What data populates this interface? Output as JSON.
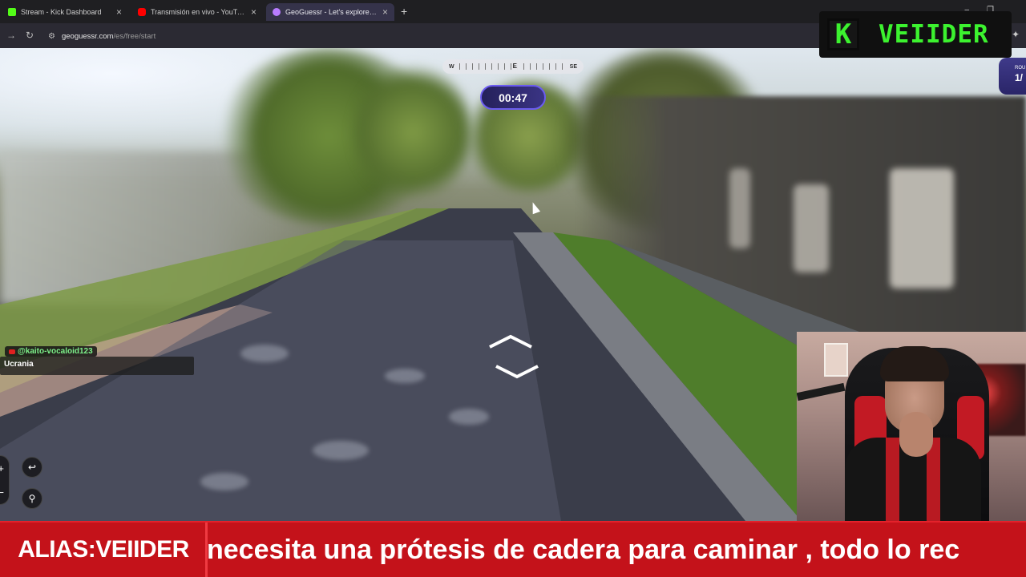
{
  "browser": {
    "tabs": [
      {
        "label": "Stream - Kick Dashboard",
        "favicon_color": "#53fc18",
        "favicon_glyph": "K"
      },
      {
        "label": "Transmisión en vivo - YouTube",
        "favicon_color": "#ff0000",
        "favicon_glyph": "▶"
      },
      {
        "label": "GeoGuessr - Let's explore the w",
        "favicon_color": "#b87cff",
        "favicon_glyph": "●"
      }
    ],
    "url_host": "geoguessr.com",
    "url_path": "/es/free/start"
  },
  "game": {
    "compass": {
      "left": "W",
      "center": "E",
      "right": "SE"
    },
    "timer": "00:47",
    "round_label": "ROU",
    "round_value": "1/"
  },
  "chat": {
    "username": "@kaito-vocaloid123",
    "message": "Ucrania"
  },
  "overlay": {
    "logo_k": "K",
    "logo_text": "VEIIDER"
  },
  "ticker": {
    "alias": "ALIAS:VEIIDER",
    "scroll_text": "necesita una prótesis de cadera para caminar , todo lo rec"
  },
  "colors": {
    "kick_green": "#3cf22f",
    "ticker_red": "#c4121a",
    "timer_purple": "#3a3484"
  }
}
